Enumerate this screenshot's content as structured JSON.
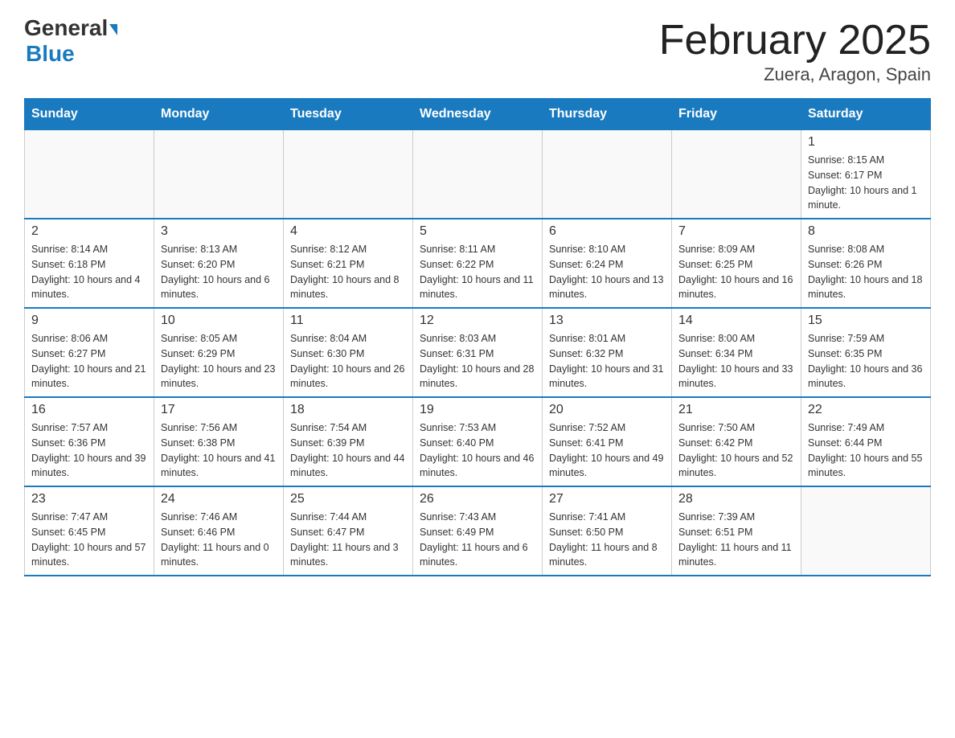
{
  "header": {
    "logo_general": "General",
    "logo_blue": "Blue",
    "title": "February 2025",
    "subtitle": "Zuera, Aragon, Spain"
  },
  "days_of_week": [
    "Sunday",
    "Monday",
    "Tuesday",
    "Wednesday",
    "Thursday",
    "Friday",
    "Saturday"
  ],
  "weeks": [
    [
      {
        "day": "",
        "info": "",
        "empty": true
      },
      {
        "day": "",
        "info": "",
        "empty": true
      },
      {
        "day": "",
        "info": "",
        "empty": true
      },
      {
        "day": "",
        "info": "",
        "empty": true
      },
      {
        "day": "",
        "info": "",
        "empty": true
      },
      {
        "day": "",
        "info": "",
        "empty": true
      },
      {
        "day": "1",
        "info": "Sunrise: 8:15 AM\nSunset: 6:17 PM\nDaylight: 10 hours and 1 minute.",
        "empty": false
      }
    ],
    [
      {
        "day": "2",
        "info": "Sunrise: 8:14 AM\nSunset: 6:18 PM\nDaylight: 10 hours and 4 minutes.",
        "empty": false
      },
      {
        "day": "3",
        "info": "Sunrise: 8:13 AM\nSunset: 6:20 PM\nDaylight: 10 hours and 6 minutes.",
        "empty": false
      },
      {
        "day": "4",
        "info": "Sunrise: 8:12 AM\nSunset: 6:21 PM\nDaylight: 10 hours and 8 minutes.",
        "empty": false
      },
      {
        "day": "5",
        "info": "Sunrise: 8:11 AM\nSunset: 6:22 PM\nDaylight: 10 hours and 11 minutes.",
        "empty": false
      },
      {
        "day": "6",
        "info": "Sunrise: 8:10 AM\nSunset: 6:24 PM\nDaylight: 10 hours and 13 minutes.",
        "empty": false
      },
      {
        "day": "7",
        "info": "Sunrise: 8:09 AM\nSunset: 6:25 PM\nDaylight: 10 hours and 16 minutes.",
        "empty": false
      },
      {
        "day": "8",
        "info": "Sunrise: 8:08 AM\nSunset: 6:26 PM\nDaylight: 10 hours and 18 minutes.",
        "empty": false
      }
    ],
    [
      {
        "day": "9",
        "info": "Sunrise: 8:06 AM\nSunset: 6:27 PM\nDaylight: 10 hours and 21 minutes.",
        "empty": false
      },
      {
        "day": "10",
        "info": "Sunrise: 8:05 AM\nSunset: 6:29 PM\nDaylight: 10 hours and 23 minutes.",
        "empty": false
      },
      {
        "day": "11",
        "info": "Sunrise: 8:04 AM\nSunset: 6:30 PM\nDaylight: 10 hours and 26 minutes.",
        "empty": false
      },
      {
        "day": "12",
        "info": "Sunrise: 8:03 AM\nSunset: 6:31 PM\nDaylight: 10 hours and 28 minutes.",
        "empty": false
      },
      {
        "day": "13",
        "info": "Sunrise: 8:01 AM\nSunset: 6:32 PM\nDaylight: 10 hours and 31 minutes.",
        "empty": false
      },
      {
        "day": "14",
        "info": "Sunrise: 8:00 AM\nSunset: 6:34 PM\nDaylight: 10 hours and 33 minutes.",
        "empty": false
      },
      {
        "day": "15",
        "info": "Sunrise: 7:59 AM\nSunset: 6:35 PM\nDaylight: 10 hours and 36 minutes.",
        "empty": false
      }
    ],
    [
      {
        "day": "16",
        "info": "Sunrise: 7:57 AM\nSunset: 6:36 PM\nDaylight: 10 hours and 39 minutes.",
        "empty": false
      },
      {
        "day": "17",
        "info": "Sunrise: 7:56 AM\nSunset: 6:38 PM\nDaylight: 10 hours and 41 minutes.",
        "empty": false
      },
      {
        "day": "18",
        "info": "Sunrise: 7:54 AM\nSunset: 6:39 PM\nDaylight: 10 hours and 44 minutes.",
        "empty": false
      },
      {
        "day": "19",
        "info": "Sunrise: 7:53 AM\nSunset: 6:40 PM\nDaylight: 10 hours and 46 minutes.",
        "empty": false
      },
      {
        "day": "20",
        "info": "Sunrise: 7:52 AM\nSunset: 6:41 PM\nDaylight: 10 hours and 49 minutes.",
        "empty": false
      },
      {
        "day": "21",
        "info": "Sunrise: 7:50 AM\nSunset: 6:42 PM\nDaylight: 10 hours and 52 minutes.",
        "empty": false
      },
      {
        "day": "22",
        "info": "Sunrise: 7:49 AM\nSunset: 6:44 PM\nDaylight: 10 hours and 55 minutes.",
        "empty": false
      }
    ],
    [
      {
        "day": "23",
        "info": "Sunrise: 7:47 AM\nSunset: 6:45 PM\nDaylight: 10 hours and 57 minutes.",
        "empty": false
      },
      {
        "day": "24",
        "info": "Sunrise: 7:46 AM\nSunset: 6:46 PM\nDaylight: 11 hours and 0 minutes.",
        "empty": false
      },
      {
        "day": "25",
        "info": "Sunrise: 7:44 AM\nSunset: 6:47 PM\nDaylight: 11 hours and 3 minutes.",
        "empty": false
      },
      {
        "day": "26",
        "info": "Sunrise: 7:43 AM\nSunset: 6:49 PM\nDaylight: 11 hours and 6 minutes.",
        "empty": false
      },
      {
        "day": "27",
        "info": "Sunrise: 7:41 AM\nSunset: 6:50 PM\nDaylight: 11 hours and 8 minutes.",
        "empty": false
      },
      {
        "day": "28",
        "info": "Sunrise: 7:39 AM\nSunset: 6:51 PM\nDaylight: 11 hours and 11 minutes.",
        "empty": false
      },
      {
        "day": "",
        "info": "",
        "empty": true
      }
    ]
  ]
}
